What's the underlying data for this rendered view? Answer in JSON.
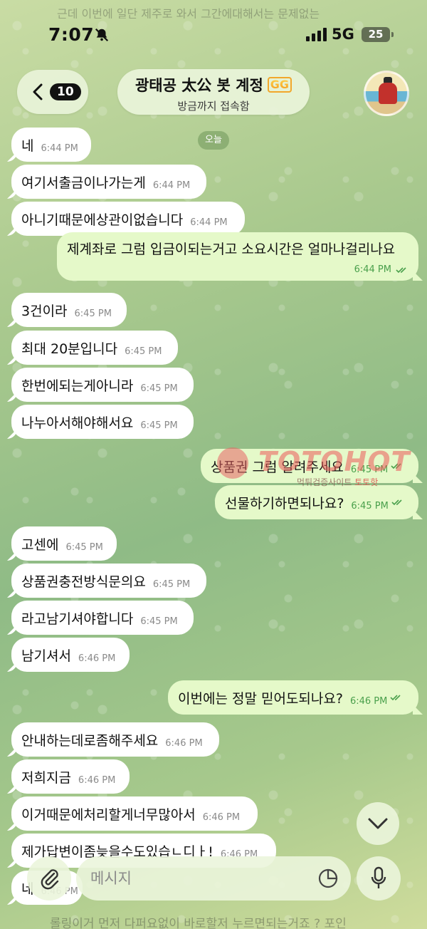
{
  "status_bar": {
    "time": "7:07",
    "network": "5G",
    "battery": "25"
  },
  "header": {
    "back_count": "10",
    "chat_name": "광태공 太公 봇 계정",
    "badge_emoji": "GG",
    "status": "방금까지 접속함"
  },
  "date_label": "오늘",
  "background_ghost_top": "근데 이번에 일단 제주로 와서 그간에대해서는 문제없는",
  "background_ghost_bottom": "롤링이거 먼저 다퍼요없이 바로할저 누르면되는거죠 ? 포인",
  "messages": [
    {
      "dir": "in",
      "text": "네",
      "time": "6:44 PM"
    },
    {
      "dir": "in",
      "text": "여기서출금이나가는게",
      "time": "6:44 PM"
    },
    {
      "dir": "in",
      "text": "아니기때문에상관이없습니다",
      "time": "6:44 PM"
    },
    {
      "dir": "out",
      "text": "제계좌로 그럼 입금이되는거고 소요시간은 얼마나걸리나요",
      "time": "6:44 PM"
    },
    {
      "dir": "in",
      "text": "3건이라",
      "time": "6:45 PM"
    },
    {
      "dir": "in",
      "text": "최대 20분입니다",
      "time": "6:45 PM"
    },
    {
      "dir": "in",
      "text": "한번에되는게아니라",
      "time": "6:45 PM"
    },
    {
      "dir": "in",
      "text": "나누아서해야해서요",
      "time": "6:45 PM"
    },
    {
      "dir": "out",
      "text": "상품권 그럼 알려주세요",
      "time": "6:45 PM"
    },
    {
      "dir": "out",
      "text": "선물하기하면되나요?",
      "time": "6:45 PM"
    },
    {
      "dir": "in",
      "text": "고센에",
      "time": "6:45 PM"
    },
    {
      "dir": "in",
      "text": "상품권충전방식문의요",
      "time": "6:45 PM"
    },
    {
      "dir": "in",
      "text": "라고남기셔야합니다",
      "time": "6:45 PM"
    },
    {
      "dir": "in",
      "text": "남기셔서",
      "time": "6:46 PM"
    },
    {
      "dir": "out",
      "text": "이번에는 정말 믿어도되나요?",
      "time": "6:46 PM"
    },
    {
      "dir": "in",
      "text": "안내하는데로좀해주세요",
      "time": "6:46 PM"
    },
    {
      "dir": "in",
      "text": "저희지금",
      "time": "6:46 PM"
    },
    {
      "dir": "in",
      "text": "이거때문에처리할게너무많아서",
      "time": "6:46 PM"
    },
    {
      "dir": "in",
      "text": "제가답변이좀늦을수도있습ㄴ디ㅏ!",
      "time": "6:46 PM"
    },
    {
      "dir": "in",
      "text": "네",
      "time": "6:46 PM"
    }
  ],
  "watermark": {
    "brand": "TOTOHOT",
    "subtitle": "먹튀검증사이트",
    "subtitle_brand": "토토핫"
  },
  "composer": {
    "placeholder": "메시지"
  },
  "icons": {
    "back": "chevron-left-icon",
    "attach": "paperclip-icon",
    "sticker": "sticker-icon",
    "mic": "microphone-icon",
    "scroll": "chevron-down-icon",
    "read": "double-check-icon"
  }
}
